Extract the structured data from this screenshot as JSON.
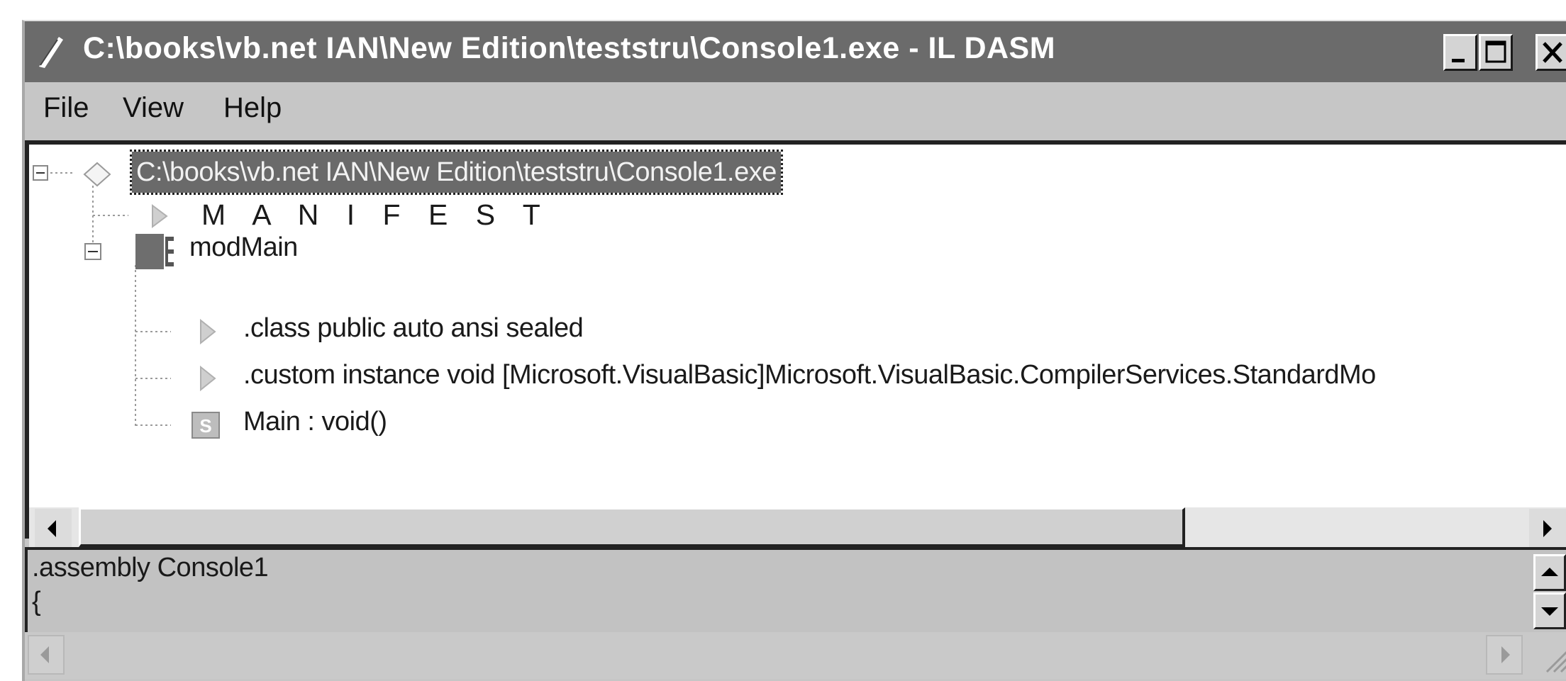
{
  "window": {
    "title": "C:\\books\\vb.net IAN\\New Edition\\teststru\\Console1.exe - IL DASM",
    "icon": "ildasm-app-icon",
    "controls": [
      "minimize-icon",
      "maximize-icon",
      "close-icon"
    ]
  },
  "menu": {
    "items": [
      "File",
      "View",
      "Help"
    ]
  },
  "tree": {
    "root": {
      "label": "C:\\books\\vb.net IAN\\New Edition\\teststru\\Console1.exe",
      "icon": "assembly-diamond-icon",
      "selected": true
    },
    "manifest": {
      "label": "M A N I F E S T",
      "icon": "triangle-icon"
    },
    "module": {
      "label": "modMain",
      "icon": "class-icon",
      "children": [
        {
          "label": ".class public auto ansi sealed",
          "icon": "triangle-icon"
        },
        {
          "label": ".custom instance void [Microsoft.VisualBasic]Microsoft.VisualBasic.CompilerServices.StandardMo",
          "icon": "triangle-icon"
        },
        {
          "label": "Main : void()",
          "icon": "static-method-icon"
        }
      ]
    }
  },
  "code_pane": {
    "lines": [
      ".assembly Console1",
      "{"
    ]
  }
}
